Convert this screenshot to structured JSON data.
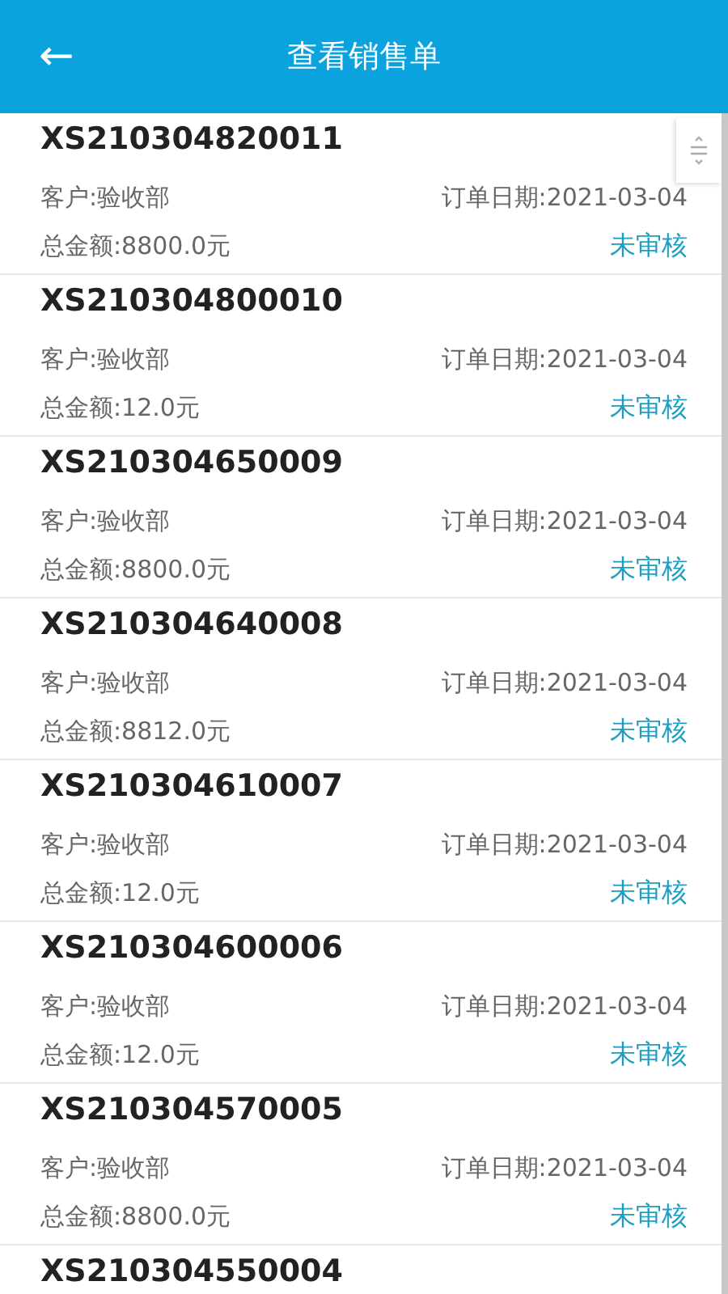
{
  "header": {
    "back": "←",
    "title": "查看销售单"
  },
  "orders": [
    {
      "number": "XS210304820011",
      "customer": "客户:验收部",
      "date": "订单日期:2021-03-04",
      "total": "总金额:8800.0元",
      "status": "未审核"
    },
    {
      "number": "XS210304800010",
      "customer": "客户:验收部",
      "date": "订单日期:2021-03-04",
      "total": "总金额:12.0元",
      "status": "未审核"
    },
    {
      "number": "XS210304650009",
      "customer": "客户:验收部",
      "date": "订单日期:2021-03-04",
      "total": "总金额:8800.0元",
      "status": "未审核"
    },
    {
      "number": "XS210304640008",
      "customer": "客户:验收部",
      "date": "订单日期:2021-03-04",
      "total": "总金额:8812.0元",
      "status": "未审核"
    },
    {
      "number": "XS210304610007",
      "customer": "客户:验收部",
      "date": "订单日期:2021-03-04",
      "total": "总金额:12.0元",
      "status": "未审核"
    },
    {
      "number": "XS210304600006",
      "customer": "客户:验收部",
      "date": "订单日期:2021-03-04",
      "total": "总金额:12.0元",
      "status": "未审核"
    },
    {
      "number": "XS210304570005",
      "customer": "客户:验收部",
      "date": "订单日期:2021-03-04",
      "total": "总金额:8800.0元",
      "status": "未审核"
    },
    {
      "number": "XS210304550004"
    }
  ]
}
